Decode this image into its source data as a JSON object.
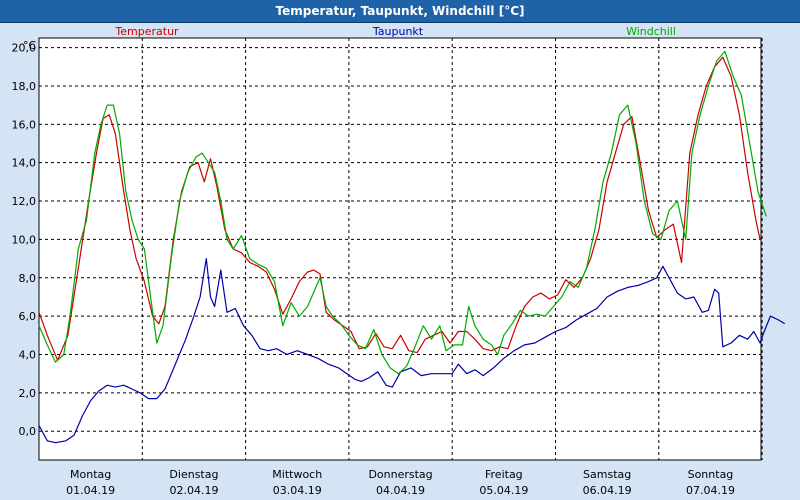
{
  "window": {
    "title": "Temperatur, Taupunkt, Windchill [°C]"
  },
  "colors": {
    "window_bg": "#d4e4f5",
    "titlebar": "#1e63a8",
    "plot_bg": "#ffffff",
    "grid": "#000000",
    "temperatur": "#cc0000",
    "taupunkt": "#0000aa",
    "windchill": "#00aa00"
  },
  "chart_data": {
    "type": "line",
    "ylabel": "°C",
    "ylim": [
      -1.5,
      20.5
    ],
    "xlim": [
      0,
      7
    ],
    "grid": true,
    "legend_placement": "top",
    "y_ticks": [
      0.0,
      2.0,
      4.0,
      6.0,
      8.0,
      10.0,
      12.0,
      14.0,
      16.0,
      18.0,
      20.0
    ],
    "y_tick_labels": [
      "0,0",
      "2,0",
      "4,0",
      "6,0",
      "8,0",
      "10,0",
      "12,0",
      "14,0",
      "16,0",
      "18,0",
      "20,0"
    ],
    "x_ticks": [
      {
        "x": 0,
        "day": "Montag",
        "date": "01.04.19"
      },
      {
        "x": 1,
        "day": "Dienstag",
        "date": "02.04.19"
      },
      {
        "x": 2,
        "day": "Mittwoch",
        "date": "03.04.19"
      },
      {
        "x": 3,
        "day": "Donnerstag",
        "date": "04.04.19"
      },
      {
        "x": 4,
        "day": "Freitag",
        "date": "05.04.19"
      },
      {
        "x": 5,
        "day": "Samstag",
        "date": "06.04.19"
      },
      {
        "x": 6,
        "day": "Sonntag",
        "date": "07.04.19"
      }
    ],
    "series": [
      {
        "name": "Temperatur",
        "color": "#cc0000",
        "points": [
          [
            0,
            6.2
          ],
          [
            0.08,
            5.0
          ],
          [
            0.18,
            3.7
          ],
          [
            0.28,
            5.0
          ],
          [
            0.38,
            8.5
          ],
          [
            0.48,
            12.0
          ],
          [
            0.56,
            14.6
          ],
          [
            0.62,
            16.3
          ],
          [
            0.68,
            16.5
          ],
          [
            0.74,
            15.5
          ],
          [
            0.82,
            12.5
          ],
          [
            0.88,
            10.5
          ],
          [
            0.94,
            9.0
          ],
          [
            1.02,
            7.8
          ],
          [
            1.1,
            6.0
          ],
          [
            1.16,
            5.6
          ],
          [
            1.22,
            6.5
          ],
          [
            1.3,
            10.0
          ],
          [
            1.38,
            12.5
          ],
          [
            1.46,
            13.8
          ],
          [
            1.54,
            14.0
          ],
          [
            1.6,
            13.0
          ],
          [
            1.66,
            14.2
          ],
          [
            1.72,
            12.8
          ],
          [
            1.8,
            10.5
          ],
          [
            1.88,
            9.5
          ],
          [
            1.96,
            9.3
          ],
          [
            2.04,
            8.8
          ],
          [
            2.12,
            8.6
          ],
          [
            2.2,
            8.3
          ],
          [
            2.28,
            7.4
          ],
          [
            2.36,
            6.1
          ],
          [
            2.44,
            6.9
          ],
          [
            2.52,
            7.8
          ],
          [
            2.6,
            8.3
          ],
          [
            2.66,
            8.4
          ],
          [
            2.72,
            8.2
          ],
          [
            2.78,
            6.2
          ],
          [
            2.86,
            5.8
          ],
          [
            2.94,
            5.5
          ],
          [
            3.02,
            5.2
          ],
          [
            3.1,
            4.3
          ],
          [
            3.18,
            4.4
          ],
          [
            3.26,
            5.1
          ],
          [
            3.34,
            4.4
          ],
          [
            3.42,
            4.3
          ],
          [
            3.5,
            5.0
          ],
          [
            3.58,
            4.2
          ],
          [
            3.66,
            4.1
          ],
          [
            3.74,
            4.8
          ],
          [
            3.82,
            5.0
          ],
          [
            3.9,
            5.2
          ],
          [
            3.98,
            4.6
          ],
          [
            4.06,
            5.2
          ],
          [
            4.14,
            5.2
          ],
          [
            4.22,
            4.8
          ],
          [
            4.3,
            4.3
          ],
          [
            4.38,
            4.2
          ],
          [
            4.46,
            4.4
          ],
          [
            4.54,
            4.3
          ],
          [
            4.62,
            5.5
          ],
          [
            4.7,
            6.5
          ],
          [
            4.78,
            7.0
          ],
          [
            4.86,
            7.2
          ],
          [
            4.94,
            6.9
          ],
          [
            5.02,
            7.1
          ],
          [
            5.1,
            7.9
          ],
          [
            5.18,
            7.5
          ],
          [
            5.26,
            8.0
          ],
          [
            5.34,
            9.0
          ],
          [
            5.42,
            10.5
          ],
          [
            5.5,
            13.0
          ],
          [
            5.58,
            14.5
          ],
          [
            5.66,
            16.0
          ],
          [
            5.74,
            16.4
          ],
          [
            5.82,
            14.0
          ],
          [
            5.9,
            11.5
          ],
          [
            5.98,
            10.1
          ],
          [
            6.06,
            10.5
          ],
          [
            6.14,
            10.8
          ],
          [
            6.22,
            8.8
          ],
          [
            6.3,
            14.5
          ],
          [
            6.38,
            16.5
          ],
          [
            6.46,
            18.0
          ],
          [
            6.54,
            19.0
          ],
          [
            6.62,
            19.5
          ],
          [
            6.7,
            18.5
          ],
          [
            6.78,
            16.5
          ],
          [
            6.86,
            13.5
          ],
          [
            6.94,
            11.0
          ],
          [
            6.98,
            10.0
          ]
        ]
      },
      {
        "name": "Taupunkt",
        "color": "#0000aa",
        "points": [
          [
            0,
            0.3
          ],
          [
            0.08,
            -0.5
          ],
          [
            0.16,
            -0.6
          ],
          [
            0.26,
            -0.5
          ],
          [
            0.34,
            -0.2
          ],
          [
            0.42,
            0.8
          ],
          [
            0.5,
            1.6
          ],
          [
            0.58,
            2.1
          ],
          [
            0.66,
            2.4
          ],
          [
            0.74,
            2.3
          ],
          [
            0.82,
            2.4
          ],
          [
            0.9,
            2.2
          ],
          [
            0.98,
            2.0
          ],
          [
            1.06,
            1.7
          ],
          [
            1.14,
            1.7
          ],
          [
            1.22,
            2.2
          ],
          [
            1.32,
            3.5
          ],
          [
            1.42,
            4.8
          ],
          [
            1.5,
            6.0
          ],
          [
            1.56,
            7.0
          ],
          [
            1.62,
            9.0
          ],
          [
            1.66,
            7.0
          ],
          [
            1.7,
            6.5
          ],
          [
            1.76,
            8.4
          ],
          [
            1.82,
            6.2
          ],
          [
            1.9,
            6.4
          ],
          [
            1.98,
            5.5
          ],
          [
            2.06,
            5.0
          ],
          [
            2.14,
            4.3
          ],
          [
            2.22,
            4.2
          ],
          [
            2.3,
            4.3
          ],
          [
            2.4,
            4.0
          ],
          [
            2.5,
            4.2
          ],
          [
            2.6,
            4.0
          ],
          [
            2.7,
            3.8
          ],
          [
            2.8,
            3.5
          ],
          [
            2.9,
            3.3
          ],
          [
            2.98,
            3.0
          ],
          [
            3.06,
            2.7
          ],
          [
            3.12,
            2.6
          ],
          [
            3.2,
            2.8
          ],
          [
            3.28,
            3.1
          ],
          [
            3.36,
            2.4
          ],
          [
            3.42,
            2.3
          ],
          [
            3.5,
            3.1
          ],
          [
            3.6,
            3.3
          ],
          [
            3.7,
            2.9
          ],
          [
            3.8,
            3.0
          ],
          [
            3.9,
            3.0
          ],
          [
            4.0,
            3.0
          ],
          [
            4.06,
            3.5
          ],
          [
            4.14,
            3.0
          ],
          [
            4.22,
            3.2
          ],
          [
            4.3,
            2.9
          ],
          [
            4.4,
            3.3
          ],
          [
            4.5,
            3.8
          ],
          [
            4.6,
            4.2
          ],
          [
            4.7,
            4.5
          ],
          [
            4.8,
            4.6
          ],
          [
            4.9,
            4.9
          ],
          [
            5.0,
            5.2
          ],
          [
            5.1,
            5.4
          ],
          [
            5.2,
            5.8
          ],
          [
            5.3,
            6.1
          ],
          [
            5.4,
            6.4
          ],
          [
            5.5,
            7.0
          ],
          [
            5.6,
            7.3
          ],
          [
            5.7,
            7.5
          ],
          [
            5.8,
            7.6
          ],
          [
            5.9,
            7.8
          ],
          [
            5.98,
            8.0
          ],
          [
            6.04,
            8.6
          ],
          [
            6.1,
            8.0
          ],
          [
            6.18,
            7.2
          ],
          [
            6.26,
            6.9
          ],
          [
            6.34,
            7.0
          ],
          [
            6.42,
            6.2
          ],
          [
            6.48,
            6.3
          ],
          [
            6.54,
            7.4
          ],
          [
            6.58,
            7.2
          ],
          [
            6.62,
            4.4
          ],
          [
            6.7,
            4.6
          ],
          [
            6.78,
            5.0
          ],
          [
            6.86,
            4.8
          ],
          [
            6.92,
            5.2
          ],
          [
            6.98,
            4.6
          ],
          [
            7.02,
            5.2
          ],
          [
            7.08,
            6.0
          ],
          [
            7.16,
            5.8
          ],
          [
            7.22,
            5.6
          ]
        ]
      },
      {
        "name": "Windchill",
        "color": "#00aa00",
        "points": [
          [
            0,
            5.5
          ],
          [
            0.08,
            4.5
          ],
          [
            0.16,
            3.6
          ],
          [
            0.24,
            4.0
          ],
          [
            0.3,
            6.0
          ],
          [
            0.38,
            9.5
          ],
          [
            0.46,
            11.0
          ],
          [
            0.54,
            14.5
          ],
          [
            0.6,
            16.0
          ],
          [
            0.66,
            17.0
          ],
          [
            0.72,
            17.0
          ],
          [
            0.78,
            15.5
          ],
          [
            0.84,
            12.5
          ],
          [
            0.9,
            11.0
          ],
          [
            0.96,
            10.0
          ],
          [
            1.02,
            9.5
          ],
          [
            1.08,
            7.0
          ],
          [
            1.14,
            4.6
          ],
          [
            1.2,
            5.5
          ],
          [
            1.28,
            9.0
          ],
          [
            1.36,
            12.0
          ],
          [
            1.44,
            13.5
          ],
          [
            1.52,
            14.3
          ],
          [
            1.58,
            14.5
          ],
          [
            1.64,
            14.0
          ],
          [
            1.7,
            13.5
          ],
          [
            1.76,
            12.0
          ],
          [
            1.82,
            10.0
          ],
          [
            1.88,
            9.5
          ],
          [
            1.96,
            10.2
          ],
          [
            2.04,
            9.0
          ],
          [
            2.12,
            8.7
          ],
          [
            2.2,
            8.5
          ],
          [
            2.28,
            7.8
          ],
          [
            2.36,
            5.5
          ],
          [
            2.44,
            6.7
          ],
          [
            2.52,
            6.0
          ],
          [
            2.6,
            6.5
          ],
          [
            2.68,
            7.5
          ],
          [
            2.72,
            8.0
          ],
          [
            2.78,
            6.5
          ],
          [
            2.84,
            6.0
          ],
          [
            2.92,
            5.6
          ],
          [
            3.0,
            5.0
          ],
          [
            3.08,
            4.5
          ],
          [
            3.16,
            4.3
          ],
          [
            3.24,
            5.3
          ],
          [
            3.32,
            4.0
          ],
          [
            3.4,
            3.3
          ],
          [
            3.48,
            3.0
          ],
          [
            3.56,
            3.4
          ],
          [
            3.64,
            4.4
          ],
          [
            3.72,
            5.5
          ],
          [
            3.8,
            4.8
          ],
          [
            3.88,
            5.5
          ],
          [
            3.94,
            4.2
          ],
          [
            4.02,
            4.5
          ],
          [
            4.1,
            4.5
          ],
          [
            4.16,
            6.5
          ],
          [
            4.22,
            5.5
          ],
          [
            4.3,
            4.8
          ],
          [
            4.38,
            4.5
          ],
          [
            4.44,
            4.0
          ],
          [
            4.5,
            5.0
          ],
          [
            4.58,
            5.6
          ],
          [
            4.66,
            6.3
          ],
          [
            4.74,
            6.0
          ],
          [
            4.82,
            6.1
          ],
          [
            4.9,
            6.0
          ],
          [
            4.98,
            6.5
          ],
          [
            5.06,
            7.0
          ],
          [
            5.14,
            7.8
          ],
          [
            5.22,
            7.5
          ],
          [
            5.3,
            8.5
          ],
          [
            5.38,
            10.5
          ],
          [
            5.46,
            13.0
          ],
          [
            5.54,
            14.5
          ],
          [
            5.62,
            16.5
          ],
          [
            5.7,
            17.0
          ],
          [
            5.78,
            15.0
          ],
          [
            5.86,
            12.0
          ],
          [
            5.94,
            10.3
          ],
          [
            6.02,
            10.0
          ],
          [
            6.1,
            11.5
          ],
          [
            6.18,
            12.0
          ],
          [
            6.26,
            10.0
          ],
          [
            6.32,
            14.5
          ],
          [
            6.4,
            16.5
          ],
          [
            6.48,
            18.0
          ],
          [
            6.56,
            19.3
          ],
          [
            6.64,
            19.8
          ],
          [
            6.72,
            18.5
          ],
          [
            6.8,
            17.5
          ],
          [
            6.88,
            15.0
          ],
          [
            6.96,
            12.5
          ],
          [
            7.04,
            11.2
          ]
        ]
      }
    ]
  }
}
